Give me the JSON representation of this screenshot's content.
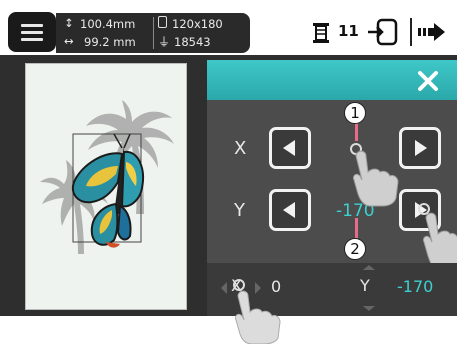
{
  "topbar": {
    "menu_icon": "hamburger-menu-icon",
    "height_value": "100.4mm",
    "width_value": "99.2 mm",
    "hoop_size": "120x180",
    "stitch_count": "18543",
    "thread_count": "11",
    "thread_icon": "spool-icon",
    "hoop_move_icon": "hoop-move-icon",
    "next_icon": "next-arrow-icon"
  },
  "edit_panel": {
    "close_icon": "close-icon",
    "x_label": "X",
    "y_label": "Y",
    "y_value": "-170",
    "accent_color": "#3ec6c6",
    "value_color": "#3ed0d0"
  },
  "bottom_info": {
    "x_label": "X",
    "x_value": "0",
    "y_label": "Y",
    "y_value": "-170"
  },
  "callouts": {
    "one": "1",
    "two": "2"
  }
}
